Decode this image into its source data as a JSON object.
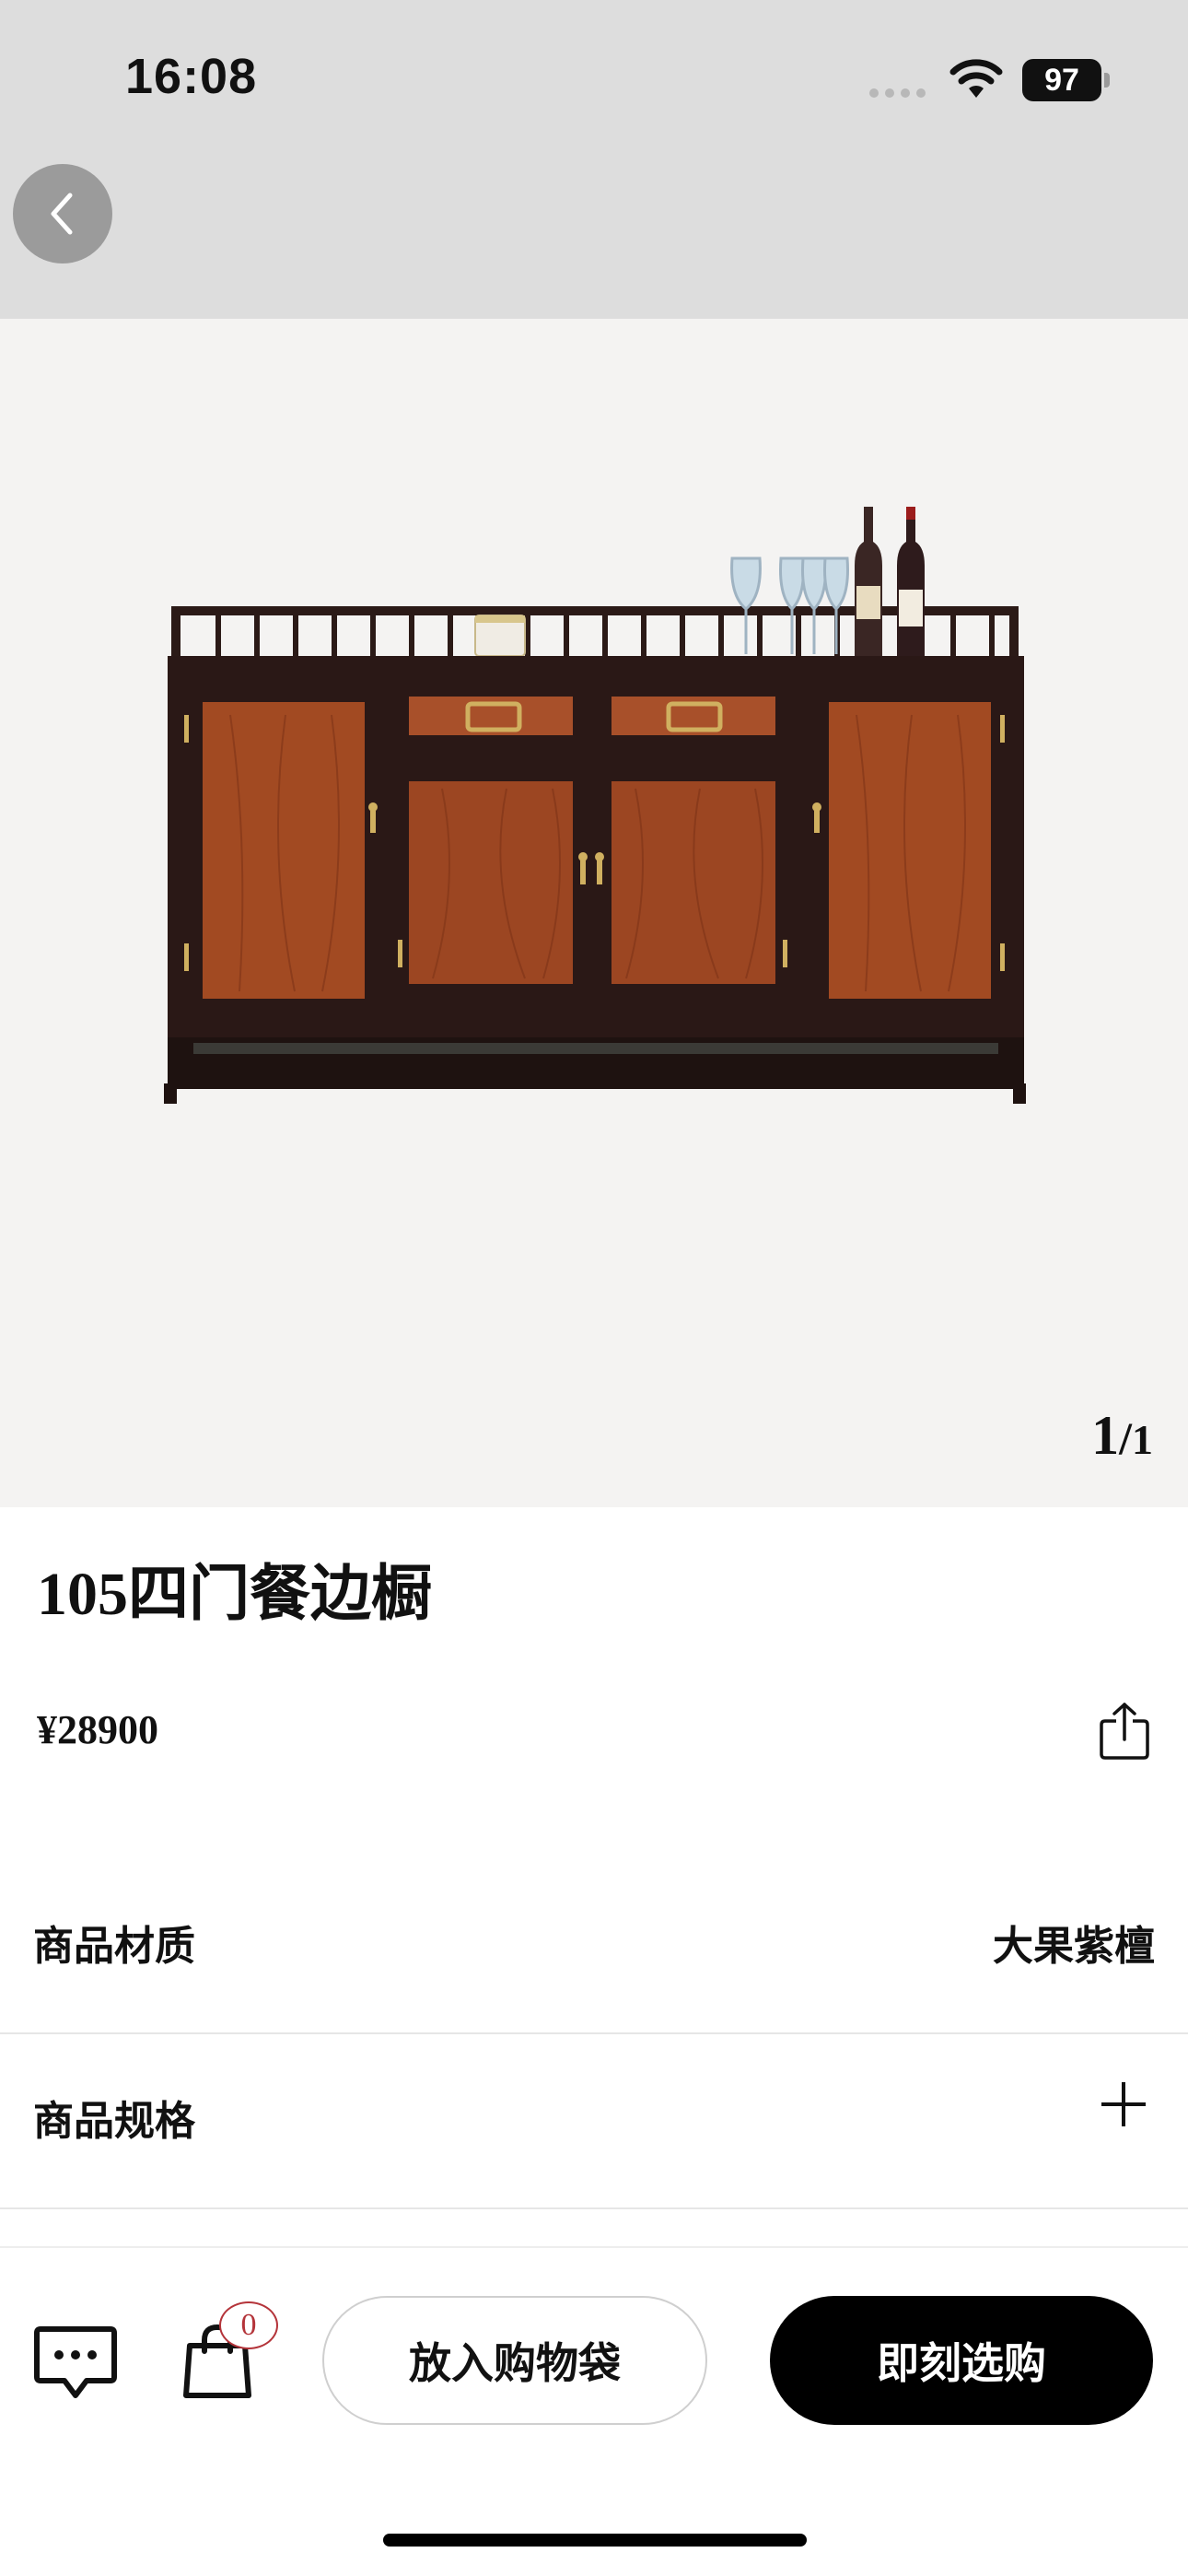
{
  "status_bar": {
    "time": "16:08",
    "battery": "97",
    "icons": [
      "signal-dots-icon",
      "wifi-icon",
      "battery-icon"
    ]
  },
  "nav": {
    "back_icon": "chevron-left-icon"
  },
  "gallery": {
    "image_description": "sideboard-image",
    "current": "1",
    "separator": "/",
    "total": "1"
  },
  "product": {
    "title": "105四门餐边橱",
    "price": "¥28900",
    "share_icon": "share-icon"
  },
  "attributes": [
    {
      "label": "商品材质",
      "value": "大果紫檀"
    },
    {
      "label": "商品规格",
      "icon": "plus-icon"
    }
  ],
  "bottom_bar": {
    "chat_icon": "chat-icon",
    "bag_icon": "shopping-bag-icon",
    "bag_count": "0",
    "add_to_bag_label": "放入购物袋",
    "buy_now_label": "即刻选购"
  },
  "colors": {
    "status_bg": "#dddddd",
    "gallery_bg": "#f4f3f2",
    "badge": "#b4343a",
    "primary_button": "#000000"
  }
}
